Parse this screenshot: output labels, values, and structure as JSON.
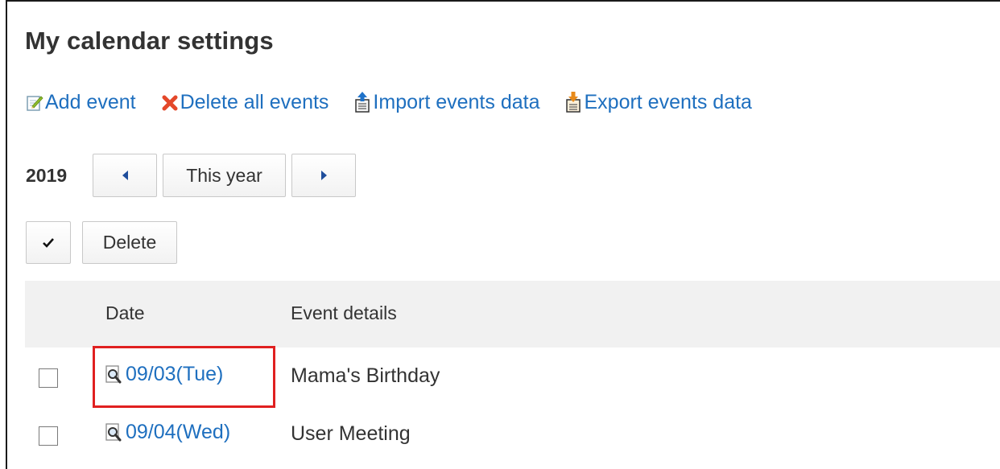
{
  "page": {
    "title": "My calendar settings"
  },
  "toolbar": {
    "add_event": "Add event",
    "delete_all": "Delete all events",
    "import_data": "Import events data",
    "export_data": "Export events data"
  },
  "year_nav": {
    "year": "2019",
    "this_year": "This year"
  },
  "actions": {
    "delete": "Delete"
  },
  "table": {
    "headers": {
      "date": "Date",
      "details": "Event details"
    },
    "rows": [
      {
        "date": "09/03(Tue)",
        "details": "Mama's Birthday",
        "checked": false
      },
      {
        "date": "09/04(Wed)",
        "details": "User Meeting",
        "checked": false
      }
    ]
  },
  "icons": {
    "add": "add-event-icon",
    "delete_all": "delete-x-icon",
    "import": "import-upload-icon",
    "export": "export-download-icon",
    "prev": "triangle-left-icon",
    "next": "triangle-right-icon",
    "check": "checkmark-icon",
    "view": "magnifier-document-icon"
  },
  "colors": {
    "link": "#1e6fbf",
    "highlight": "#e02020",
    "header_bg": "#f1f1f1"
  }
}
